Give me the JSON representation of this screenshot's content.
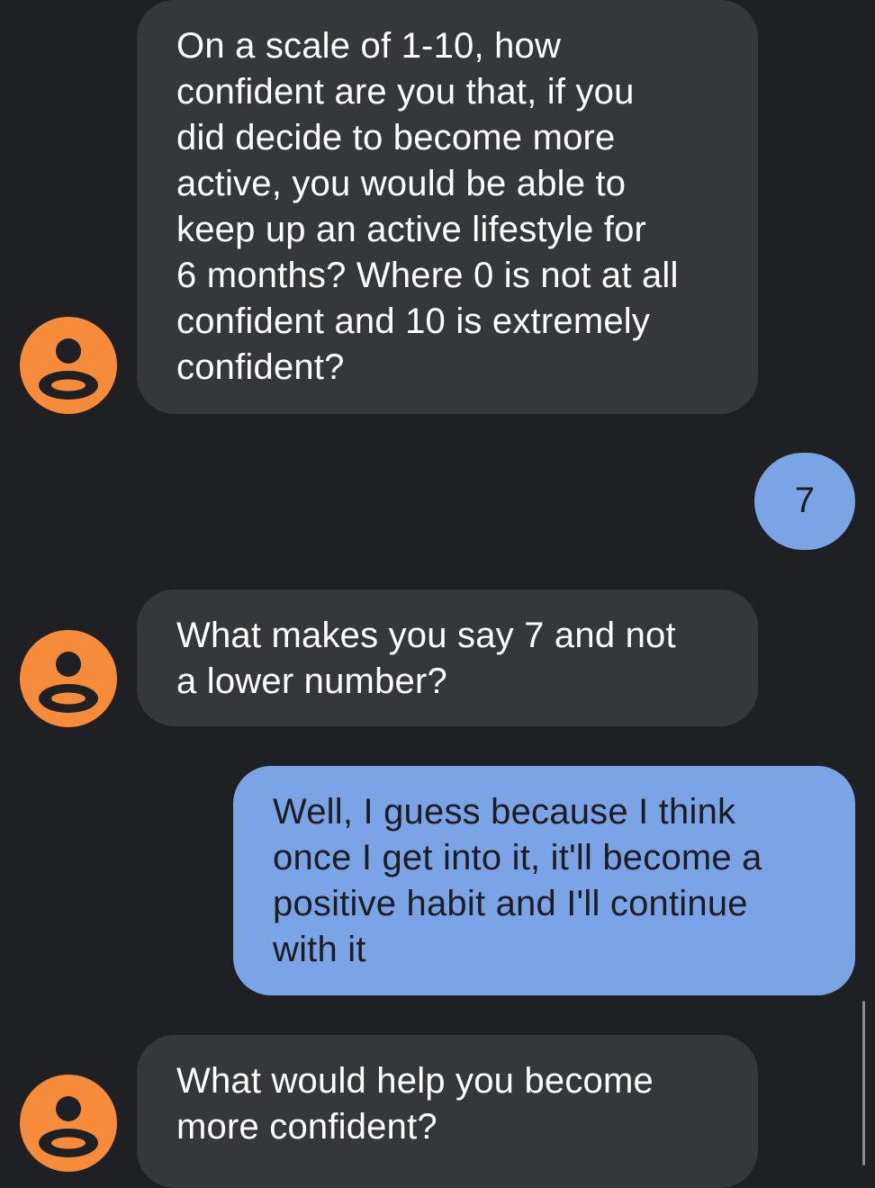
{
  "messages": [
    {
      "sender": "contact",
      "text": "On a scale of 1-10, how\nconfident are you that, if you\ndid decide to become more\nactive, you would be able to\nkeep up an active lifestyle for\n6 months? Where 0 is not at all\nconfident and 10 is extremely\nconfident?"
    },
    {
      "sender": "me",
      "text": "7"
    },
    {
      "sender": "contact",
      "text": "What makes you say 7 and not\na lower number?"
    },
    {
      "sender": "me",
      "text": "Well, I guess because I think\nonce I get into it, it'll become a\npositive habit and I'll continue\nwith it"
    },
    {
      "sender": "contact",
      "text": "What would help you become\nmore confident?"
    }
  ],
  "avatar_icon": "person-icon",
  "colors": {
    "background": "#1f2023",
    "incoming_bubble": "#36373b",
    "outgoing_bubble": "#7ba4e6",
    "avatar": "#f68c3a"
  }
}
